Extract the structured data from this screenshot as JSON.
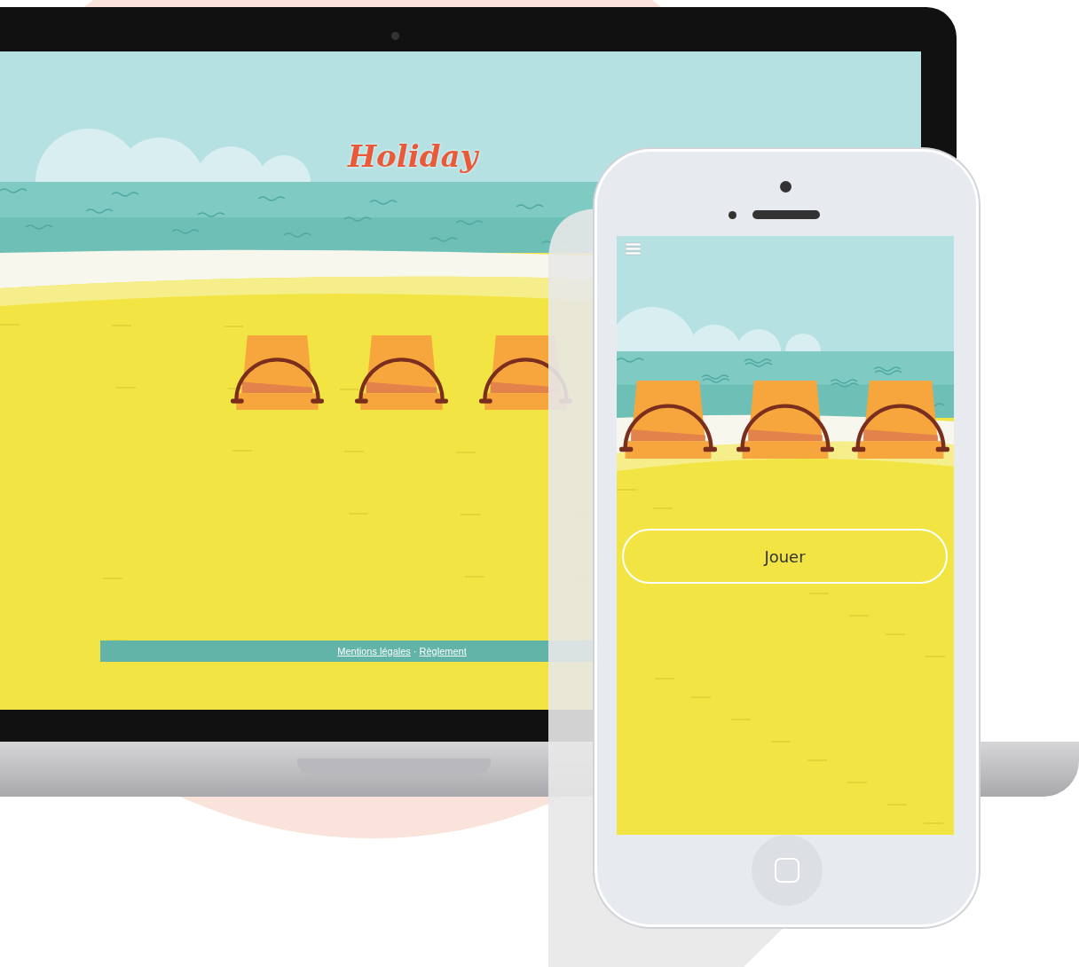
{
  "laptop": {
    "logo": "Holiday",
    "footer": {
      "links": [
        "Mentions légales",
        "Règlement"
      ],
      "separator": "·"
    }
  },
  "phone": {
    "play_button": "Jouer"
  }
}
